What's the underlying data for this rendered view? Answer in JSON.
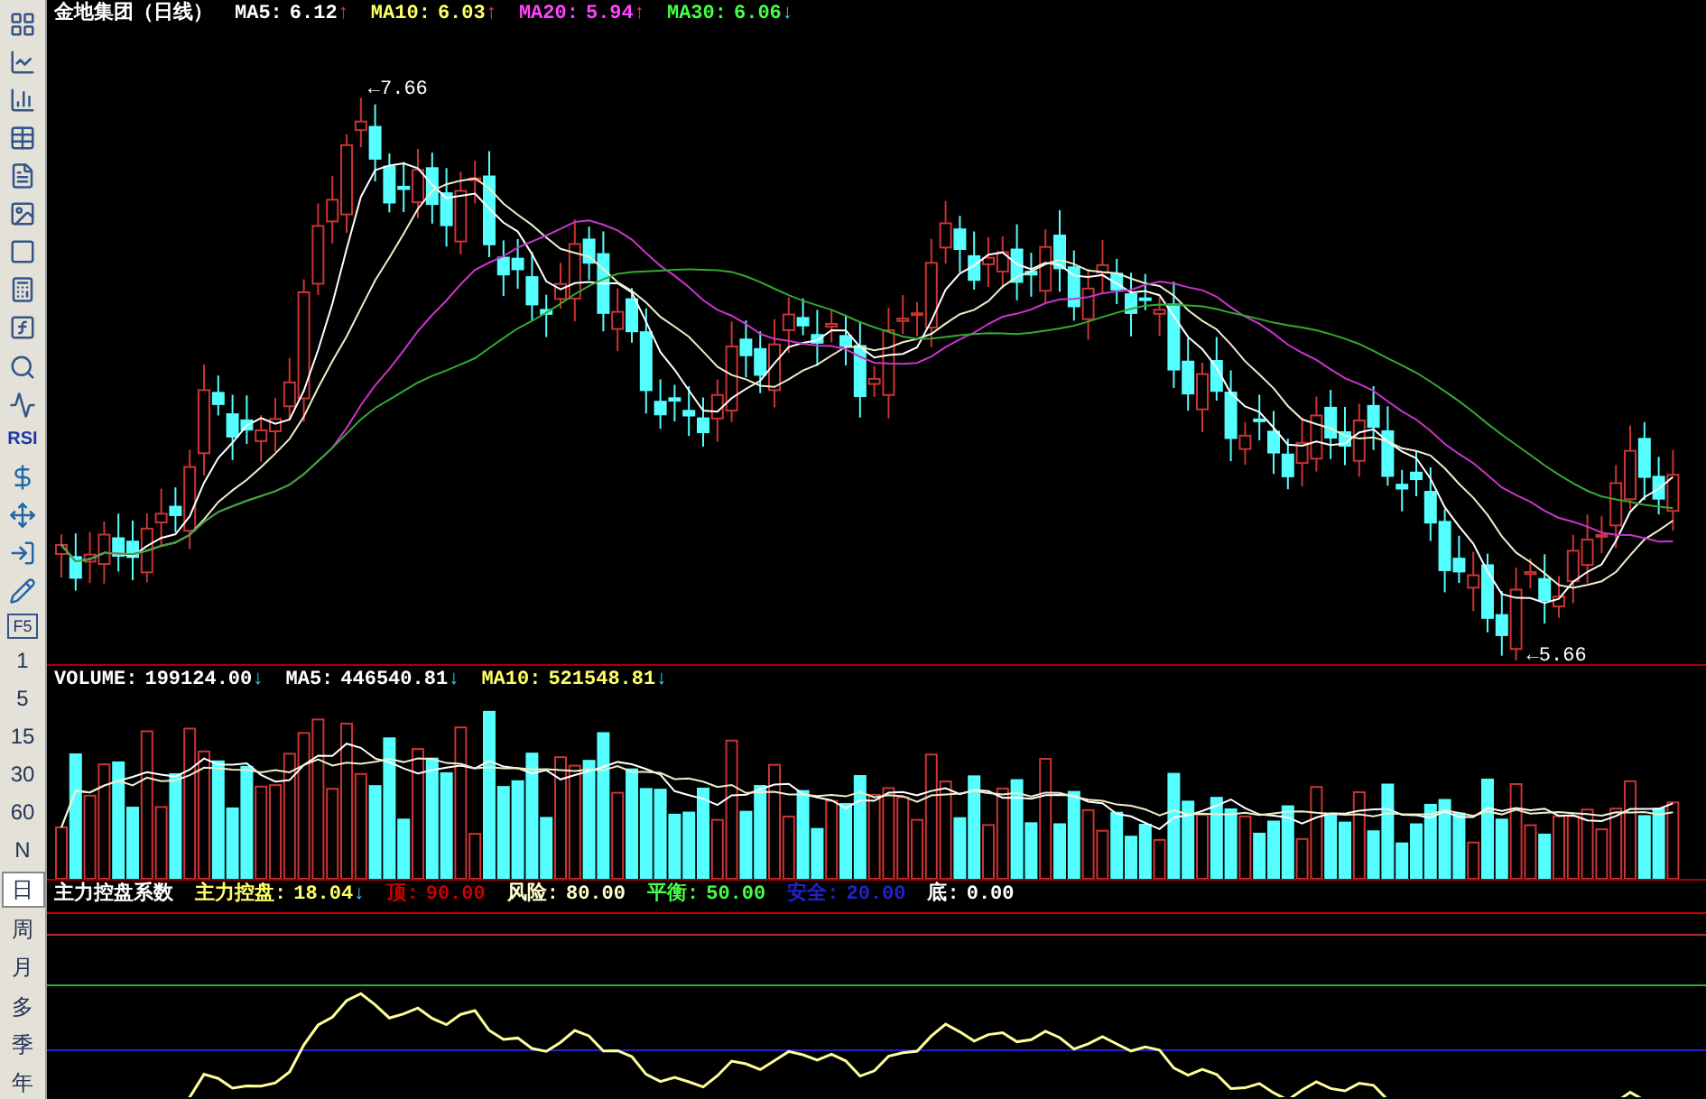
{
  "toolbar": {
    "rsi_label": "RSI",
    "f5_label": "F5",
    "periods": [
      {
        "label": "1",
        "selected": false
      },
      {
        "label": "5",
        "selected": false
      },
      {
        "label": "15",
        "selected": false
      },
      {
        "label": "30",
        "selected": false
      },
      {
        "label": "60",
        "selected": false
      },
      {
        "label": "N",
        "selected": false
      },
      {
        "label": "日",
        "selected": true
      },
      {
        "label": "周",
        "selected": false
      },
      {
        "label": "月",
        "selected": false
      },
      {
        "label": "多",
        "selected": false
      },
      {
        "label": "季",
        "selected": false
      },
      {
        "label": "年",
        "selected": false
      }
    ]
  },
  "price_pane": {
    "title": "金地集团（日线）",
    "indicators": [
      {
        "label": "MA5:",
        "value": "6.12",
        "trend": "↑",
        "rising": true,
        "color": "#ffffff"
      },
      {
        "label": "MA10:",
        "value": "6.03",
        "trend": "↑",
        "rising": true,
        "color": "#ffff66"
      },
      {
        "label": "MA20:",
        "value": "5.94",
        "trend": "↑",
        "rising": true,
        "color": "#ff44ff"
      },
      {
        "label": "MA30:",
        "value": "6.06",
        "trend": "↓",
        "rising": false,
        "color": "#44ff44"
      }
    ],
    "high_marker": "←7.66",
    "low_marker": "←5.66"
  },
  "volume_pane": {
    "indicators": [
      {
        "label": "VOLUME:",
        "value": "199124.00",
        "trend": "↓",
        "rising": false,
        "color": "#ffffff"
      },
      {
        "label": "MA5:",
        "value": "446540.81",
        "trend": "↓",
        "rising": false,
        "color": "#ffffff"
      },
      {
        "label": "MA10:",
        "value": "521548.81",
        "trend": "↓",
        "rising": false,
        "color": "#ffff66"
      }
    ]
  },
  "indicator_pane": {
    "title": "主力控盘系数",
    "indicators": [
      {
        "label": "主力控盘:",
        "value": "18.04",
        "trend": "↓",
        "rising": false,
        "color": "#ffff66"
      },
      {
        "label": "顶:",
        "value": "90.00",
        "color": "#cc0000"
      },
      {
        "label": "风险:",
        "value": "80.00",
        "color": "#ffffcc"
      },
      {
        "label": "平衡:",
        "value": "50.00",
        "color": "#44ff44"
      },
      {
        "label": "安全:",
        "value": "20.00",
        "color": "#2222cc"
      },
      {
        "label": "底:",
        "value": "0.00",
        "color": "#ffffff"
      }
    ]
  }
}
